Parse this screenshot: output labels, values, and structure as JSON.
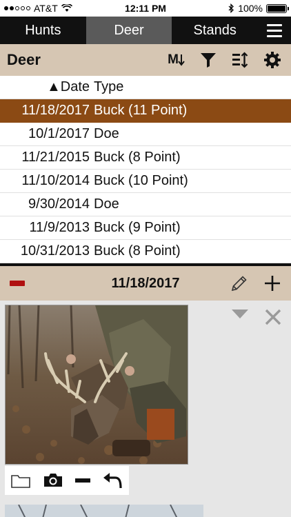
{
  "status_bar": {
    "carrier": "AT&T",
    "time": "12:11 PM",
    "battery": "100%"
  },
  "tabs": [
    {
      "label": "Hunts",
      "active": false
    },
    {
      "label": "Deer",
      "active": true
    },
    {
      "label": "Stands",
      "active": false
    }
  ],
  "section": {
    "title": "Deer",
    "sort_label": "M"
  },
  "table": {
    "columns": [
      "Date",
      "Type"
    ],
    "sort_indicator": "▲",
    "rows": [
      {
        "date": "11/18/2017",
        "type": "Buck (11 Point)",
        "selected": true
      },
      {
        "date": "10/1/2017",
        "type": "Doe",
        "selected": false
      },
      {
        "date": "11/21/2015",
        "type": "Buck (8 Point)",
        "selected": false
      },
      {
        "date": "11/10/2014",
        "type": "Buck (10 Point)",
        "selected": false
      },
      {
        "date": "9/30/2014",
        "type": "Doe",
        "selected": false
      },
      {
        "date": "11/9/2013",
        "type": "Buck (9 Point)",
        "selected": false
      },
      {
        "date": "10/31/2013",
        "type": "Buck (8 Point)",
        "selected": false
      }
    ]
  },
  "detail": {
    "date": "11/18/2017"
  },
  "colors": {
    "accent_brown": "#8b4a14",
    "header_tan": "#d6c6b3",
    "tab_bar": "#111111",
    "tab_active": "#5a5a5a",
    "collapse_red": "#b01010"
  },
  "icons": {
    "sort_alpha": "sort-alpha-icon",
    "filter": "filter-icon",
    "sort_order": "sort-order-icon",
    "settings": "gear-icon",
    "menu": "hamburger-menu-icon",
    "edit": "pencil-icon",
    "add": "plus-icon",
    "collapse": "collapse-icon",
    "expand": "chevron-down-icon",
    "close": "close-icon",
    "folder": "folder-icon",
    "camera": "camera-icon",
    "remove": "minus-icon",
    "undo": "undo-icon"
  }
}
